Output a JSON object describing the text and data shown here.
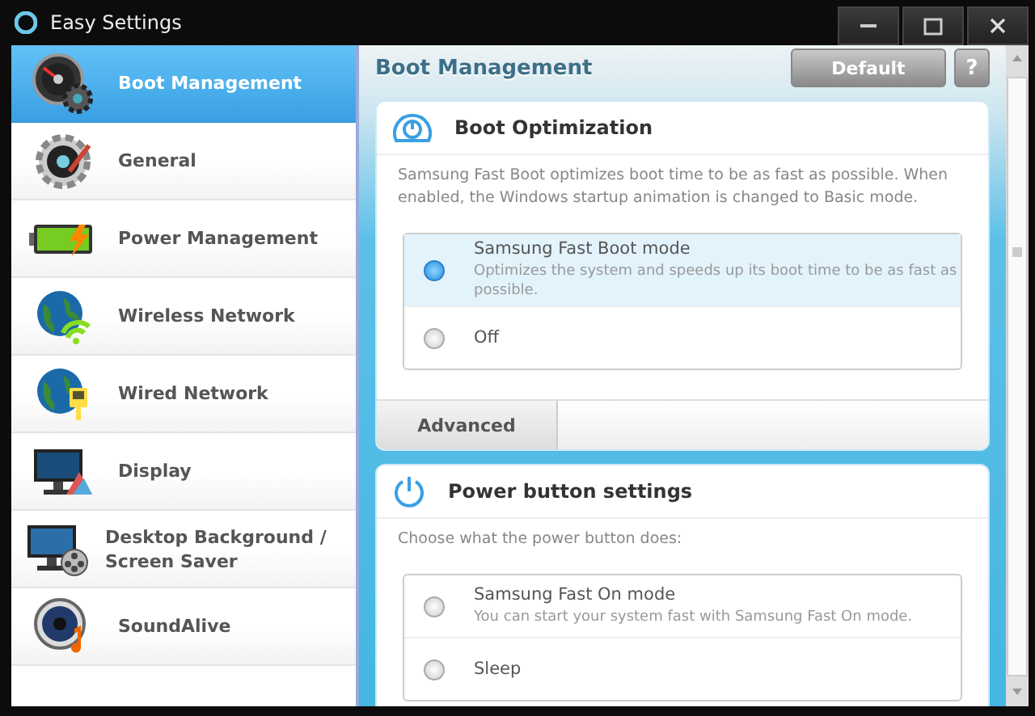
{
  "window": {
    "title": "Easy Settings"
  },
  "sidebar": {
    "items": [
      {
        "label": "Boot Management",
        "selected": true
      },
      {
        "label": "General",
        "selected": false
      },
      {
        "label": "Power Management",
        "selected": false
      },
      {
        "label": "Wireless Network",
        "selected": false
      },
      {
        "label": "Wired Network",
        "selected": false
      },
      {
        "label": "Display",
        "selected": false
      },
      {
        "label": "Desktop Background / Screen Saver",
        "selected": false
      },
      {
        "label": "SoundAlive",
        "selected": false
      }
    ]
  },
  "header": {
    "title": "Boot Management",
    "default_button": "Default",
    "help_button": "?"
  },
  "sections": [
    {
      "title": "Boot Optimization",
      "description": "Samsung Fast Boot optimizes boot time to be as fast as possible. When enabled, the Windows startup animation is changed to Basic mode.",
      "options": [
        {
          "label": "Samsung Fast Boot mode",
          "detail": "Optimizes the system and speeds up its boot time to be as fast as possible.",
          "selected": true
        },
        {
          "label": "Off",
          "selected": false
        }
      ],
      "tab": "Advanced"
    },
    {
      "title": "Power button settings",
      "description": "Choose what the power button does:",
      "options": [
        {
          "label": "Samsung Fast On mode",
          "detail": "You can start your system fast with Samsung Fast On mode.",
          "selected": false
        },
        {
          "label": "Sleep",
          "selected": false
        }
      ]
    }
  ]
}
